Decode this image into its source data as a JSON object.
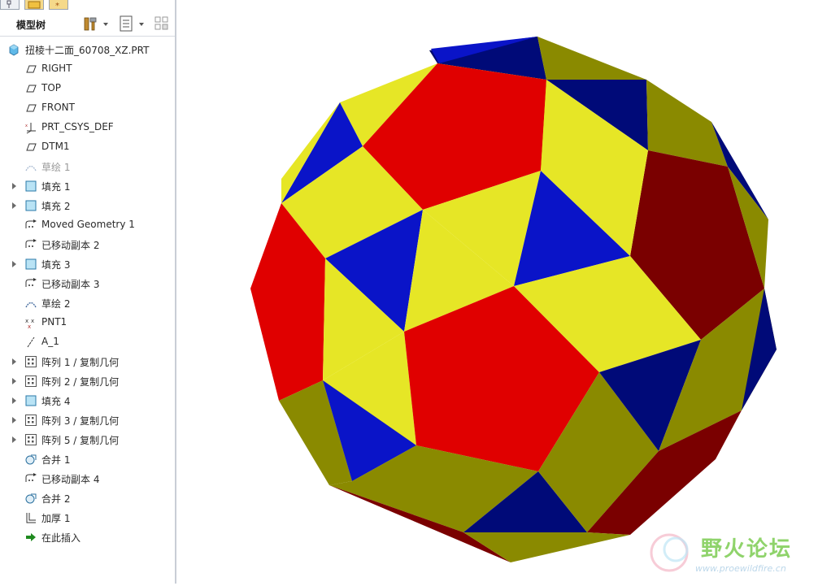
{
  "panel": {
    "title": "模型树"
  },
  "toolbar_icons": [
    "settings-hammer-icon",
    "dropdown-arrow-icon",
    "show-list-icon",
    "dropdown-arrow-icon",
    "filter-icon"
  ],
  "tree": {
    "root": "扭棱十二面_60708_XZ.PRT",
    "items": [
      {
        "label": "RIGHT",
        "icon": "datum-plane-icon",
        "expandable": false
      },
      {
        "label": "TOP",
        "icon": "datum-plane-icon",
        "expandable": false
      },
      {
        "label": "FRONT",
        "icon": "datum-plane-icon",
        "expandable": false
      },
      {
        "label": "PRT_CSYS_DEF",
        "icon": "coordinate-system-icon",
        "expandable": false
      },
      {
        "label": "DTM1",
        "icon": "datum-plane-icon",
        "expandable": false
      },
      {
        "label": "草绘 1",
        "icon": "sketch-icon",
        "expandable": false,
        "disabled": true
      },
      {
        "label": "填充 1",
        "icon": "fill-surface-icon",
        "expandable": true
      },
      {
        "label": "填充 2",
        "icon": "fill-surface-icon",
        "expandable": true
      },
      {
        "label": "Moved Geometry 1",
        "icon": "moved-copy-icon",
        "expandable": false
      },
      {
        "label": "已移动副本 2",
        "icon": "moved-copy-icon",
        "expandable": false
      },
      {
        "label": "填充 3",
        "icon": "fill-surface-icon",
        "expandable": true
      },
      {
        "label": "已移动副本 3",
        "icon": "moved-copy-icon",
        "expandable": false
      },
      {
        "label": "草绘 2",
        "icon": "sketch-icon",
        "expandable": false
      },
      {
        "label": "PNT1",
        "icon": "datum-point-icon",
        "expandable": false
      },
      {
        "label": "A_1",
        "icon": "datum-axis-icon",
        "expandable": false
      },
      {
        "label": "阵列 1 / 复制几何",
        "icon": "pattern-icon",
        "expandable": true
      },
      {
        "label": "阵列 2 / 复制几何",
        "icon": "pattern-icon",
        "expandable": true
      },
      {
        "label": "填充 4",
        "icon": "fill-surface-icon",
        "expandable": true
      },
      {
        "label": "阵列 3 / 复制几何",
        "icon": "pattern-icon",
        "expandable": true
      },
      {
        "label": "阵列 5 / 复制几何",
        "icon": "pattern-icon",
        "expandable": true
      },
      {
        "label": "合并 1",
        "icon": "merge-icon",
        "expandable": false
      },
      {
        "label": "已移动副本 4",
        "icon": "moved-copy-icon",
        "expandable": false
      },
      {
        "label": "合并 2",
        "icon": "merge-icon",
        "expandable": false
      },
      {
        "label": "加厚 1",
        "icon": "thicken-icon",
        "expandable": false
      },
      {
        "label": "在此插入",
        "icon": "insert-here-arrow-icon",
        "expandable": false
      }
    ]
  },
  "viewport": {
    "model": "snub dodecahedron",
    "colors": {
      "red": "#e00000",
      "dark_red": "#7a0000",
      "yellow": "#e6e626",
      "olive": "#8a8a00",
      "blue": "#0a14c8",
      "navy": "#000a78"
    }
  },
  "watermark": {
    "text": "野火论坛",
    "url": "www.proewildfire.cn"
  }
}
